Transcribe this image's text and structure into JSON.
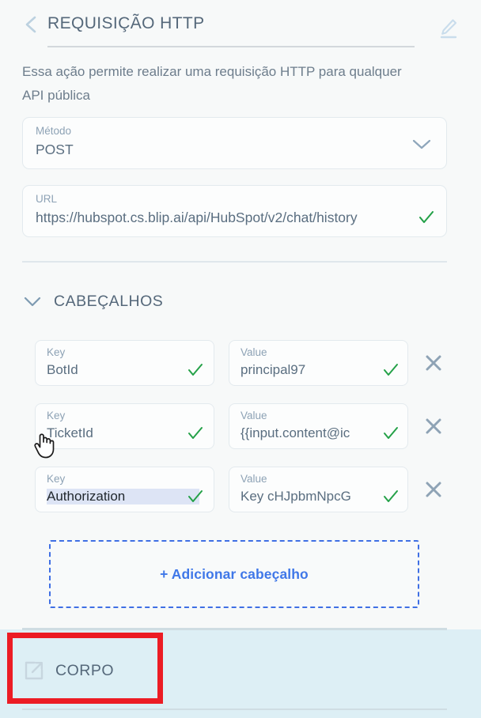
{
  "header": {
    "title": "REQUISIÇÃO HTTP",
    "back_icon": "chevron-left-icon",
    "edit_icon": "pencil-edit-icon"
  },
  "description": "Essa ação permite realizar uma requisição HTTP para qualquer API pública",
  "method_field": {
    "label": "Método",
    "value": "POST",
    "dropdown_icon": "chevron-down-icon"
  },
  "url_field": {
    "label": "URL",
    "value": "https://hubspot.cs.blip.ai/api/HubSpot/v2/chat/history",
    "valid_icon": "check-icon"
  },
  "headers_section": {
    "title": "CABEÇALHOS",
    "caret_icon": "chevron-down-icon",
    "key_label": "Key",
    "value_label": "Value",
    "rows": [
      {
        "key": "BotId",
        "value": "principal97",
        "key_valid": "check-icon",
        "value_valid": "check-icon",
        "remove_icon": "close-x-icon",
        "selected": false
      },
      {
        "key": "TicketId",
        "value": "{{input.content@ic",
        "key_valid": "check-icon",
        "value_valid": "check-icon",
        "remove_icon": "close-x-icon",
        "selected": false
      },
      {
        "key": "Authorization",
        "value": "Key cHJpbmNpcG",
        "key_valid": "check-icon",
        "value_valid": "check-icon",
        "remove_icon": "close-x-icon",
        "selected": true
      }
    ],
    "add_button_label": "+ Adicionar cabeçalho"
  },
  "body_section": {
    "title": "CORPO",
    "icon": "external-link-icon"
  },
  "annotation": {
    "highlight_color": "#ec1c24"
  },
  "colors": {
    "page_background": "#f7f9f9",
    "text_primary": "#55687a",
    "text_secondary": "#6d7d8c",
    "label": "#8da2b5",
    "accent_blue": "#3f77e8",
    "check_green": "#24a148",
    "field_border": "#e3eaee",
    "highlight_band": "#ddeff5",
    "selection": "#dde4f5"
  }
}
